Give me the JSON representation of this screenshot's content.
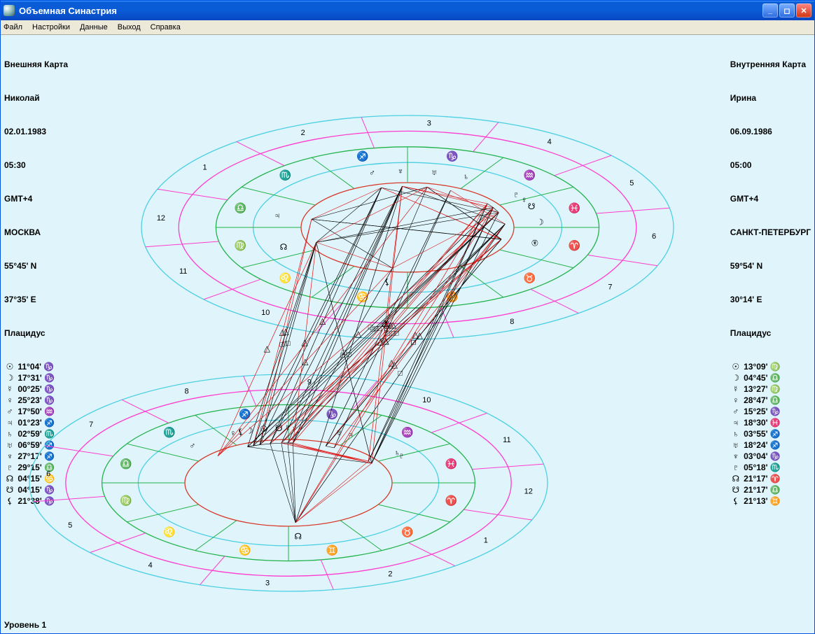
{
  "window": {
    "title": "Объемная Синастрия"
  },
  "menu": [
    "Файл",
    "Настройки",
    "Данные",
    "Выход",
    "Справка"
  ],
  "status": "Уровень 1",
  "outer_card": {
    "heading": "Внешняя Карта",
    "name": "Николай",
    "date": "02.01.1983",
    "time": "05:30",
    "tz": "GMT+4",
    "city": "МОСКВА",
    "lat": "55°45' N",
    "lon": "37°35' E",
    "house_system": "Плацидус",
    "positions": [
      {
        "glyph": "☉",
        "text": "11°04' ♑"
      },
      {
        "glyph": "☽",
        "text": "17°31' ♑"
      },
      {
        "glyph": "☿",
        "text": "00°25' ♑"
      },
      {
        "glyph": "♀",
        "text": "25°23' ♑"
      },
      {
        "glyph": "♂",
        "text": "17°50' ♒"
      },
      {
        "glyph": "♃",
        "text": "01°23' ♐"
      },
      {
        "glyph": "♄",
        "text": "02°59' ♏"
      },
      {
        "glyph": "♅",
        "text": "06°59' ♐"
      },
      {
        "glyph": "♆",
        "text": "27°17' ♐"
      },
      {
        "glyph": "♇",
        "text": "29°15' ♎"
      },
      {
        "glyph": "☊",
        "text": "04°15' ♋"
      },
      {
        "glyph": "☋",
        "text": "04°15' ♑"
      },
      {
        "glyph": "⚸",
        "text": "21°38' ♑"
      }
    ]
  },
  "inner_card": {
    "heading": "Внутренняя Карта",
    "name": "Ирина",
    "date": "06.09.1986",
    "time": "05:00",
    "tz": "GMT+4",
    "city": "САНКТ-ПЕТЕРБУРГ",
    "lat": "59°54' N",
    "lon": "30°14' E",
    "house_system": "Плацидус",
    "positions": [
      {
        "glyph": "☉",
        "text": "13°09' ♍"
      },
      {
        "glyph": "☽",
        "text": "04°45' ♎"
      },
      {
        "glyph": "☿",
        "text": "13°27' ♍"
      },
      {
        "glyph": "♀",
        "text": "28°47' ♎"
      },
      {
        "glyph": "♂",
        "text": "15°25' ♑"
      },
      {
        "glyph": "♃",
        "text": "18°30' ♓"
      },
      {
        "glyph": "♄",
        "text": "03°55' ♐"
      },
      {
        "glyph": "♅",
        "text": "18°24' ♐"
      },
      {
        "glyph": "♆",
        "text": "03°04' ♑"
      },
      {
        "glyph": "♇",
        "text": "05°18' ♏"
      },
      {
        "glyph": "☊",
        "text": "21°17' ♈"
      },
      {
        "glyph": "☋",
        "text": "21°17' ♎"
      },
      {
        "glyph": "⚸",
        "text": "21°13' ♊"
      }
    ]
  },
  "chart_data": {
    "type": "synastry-3d-biwheel",
    "house_system": "Placidus",
    "zodiac_signs": [
      "♈",
      "♉",
      "♊",
      "♋",
      "♌",
      "♍",
      "♎",
      "♏",
      "♐",
      "♑",
      "♒",
      "♓"
    ],
    "houses": [
      1,
      2,
      3,
      4,
      5,
      6,
      7,
      8,
      9,
      10,
      11,
      12
    ],
    "wheels": [
      {
        "role": "top",
        "owner": "inner_card",
        "person": "Ирина",
        "planet_longitudes_deg": {
          "Sun": 163.15,
          "Moon": 184.75,
          "Mercury": 163.45,
          "Venus": 208.78,
          "Mars": 285.42,
          "Jupiter": 348.5,
          "Saturn": 243.92,
          "Uranus": 258.4,
          "Neptune": 273.07,
          "Pluto": 215.3,
          "NorthNode": 21.28,
          "SouthNode": 201.28,
          "Lilith": 81.22
        }
      },
      {
        "role": "bottom",
        "owner": "outer_card",
        "person": "Николай",
        "planet_longitudes_deg": {
          "Sun": 281.07,
          "Moon": 287.52,
          "Mercury": 270.42,
          "Venus": 295.38,
          "Mars": 317.83,
          "Jupiter": 241.38,
          "Saturn": 212.98,
          "Uranus": 246.98,
          "Neptune": 267.28,
          "Pluto": 209.25,
          "NorthNode": 94.25,
          "SouthNode": 274.25,
          "Lilith": 291.63
        }
      }
    ],
    "aspect_types_legend": {
      "red_triangle": "trine/sextile (harmonic)",
      "black_square": "square/opposition (tense)",
      "black_line": "conjunction/other"
    },
    "note": "Aspect lines connect planets between the two tilted wheels; markers △ in red and □ in black denote aspect type along each connecting line."
  }
}
